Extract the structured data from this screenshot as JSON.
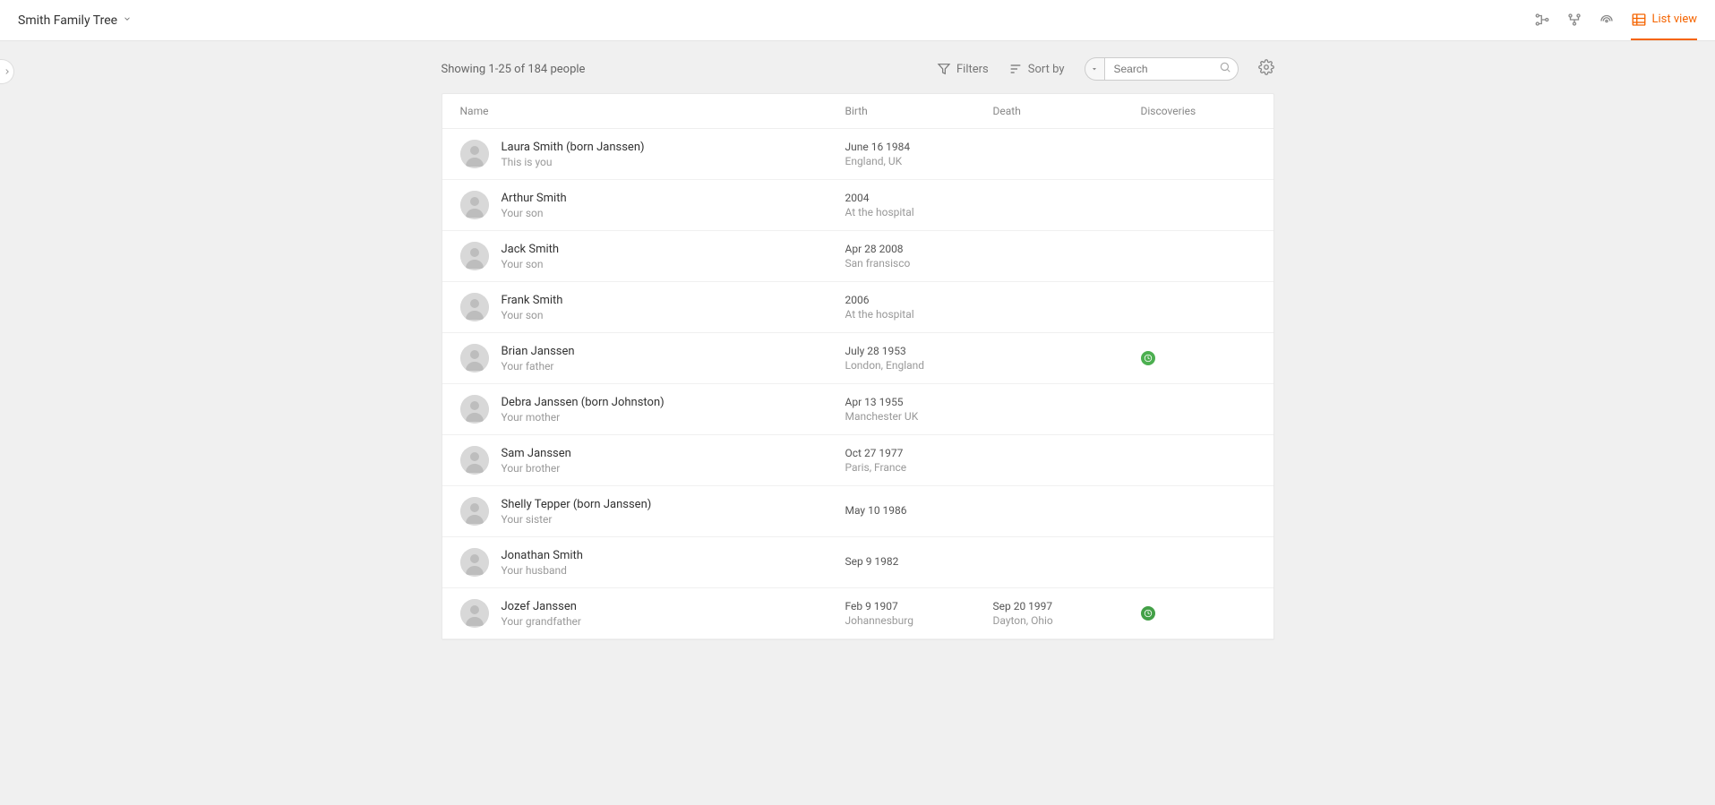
{
  "header": {
    "tree_title": "Smith Family Tree",
    "views": {
      "list_view_label": "List view"
    }
  },
  "controls": {
    "showing": "Showing 1-25 of 184 people",
    "filters_label": "Filters",
    "sortby_label": "Sort by",
    "search_placeholder": "Search"
  },
  "table": {
    "headers": {
      "name": "Name",
      "birth": "Birth",
      "death": "Death",
      "discoveries": "Discoveries"
    },
    "rows": [
      {
        "name": "Laura Smith (born Janssen)",
        "relation": "This is you",
        "birth_date": "June 16 1984",
        "birth_place": "England, UK",
        "death_date": "",
        "death_place": "",
        "has_discovery": false
      },
      {
        "name": "Arthur Smith",
        "relation": "Your son",
        "birth_date": "2004",
        "birth_place": "At the hospital",
        "death_date": "",
        "death_place": "",
        "has_discovery": false
      },
      {
        "name": "Jack Smith",
        "relation": "Your son",
        "birth_date": "Apr 28 2008",
        "birth_place": "San fransisco",
        "death_date": "",
        "death_place": "",
        "has_discovery": false
      },
      {
        "name": "Frank Smith",
        "relation": "Your son",
        "birth_date": "2006",
        "birth_place": "At the hospital",
        "death_date": "",
        "death_place": "",
        "has_discovery": false
      },
      {
        "name": "Brian Janssen",
        "relation": "Your father",
        "birth_date": "July 28 1953",
        "birth_place": "London, England",
        "death_date": "",
        "death_place": "",
        "has_discovery": true
      },
      {
        "name": "Debra Janssen (born Johnston)",
        "relation": "Your mother",
        "birth_date": "Apr 13 1955",
        "birth_place": "Manchester UK",
        "death_date": "",
        "death_place": "",
        "has_discovery": false
      },
      {
        "name": "Sam Janssen",
        "relation": "Your brother",
        "birth_date": "Oct 27 1977",
        "birth_place": "Paris, France",
        "death_date": "",
        "death_place": "",
        "has_discovery": false
      },
      {
        "name": "Shelly Tepper (born Janssen)",
        "relation": "Your sister",
        "birth_date": "May 10 1986",
        "birth_place": "",
        "death_date": "",
        "death_place": "",
        "has_discovery": false
      },
      {
        "name": "Jonathan Smith",
        "relation": "Your husband",
        "birth_date": "Sep 9 1982",
        "birth_place": "",
        "death_date": "",
        "death_place": "",
        "has_discovery": false
      },
      {
        "name": "Jozef Janssen",
        "relation": "Your grandfather",
        "birth_date": "Feb 9 1907",
        "birth_place": "Johannesburg",
        "death_date": "Sep 20 1997",
        "death_place": "Dayton, Ohio",
        "has_discovery": true
      }
    ]
  }
}
